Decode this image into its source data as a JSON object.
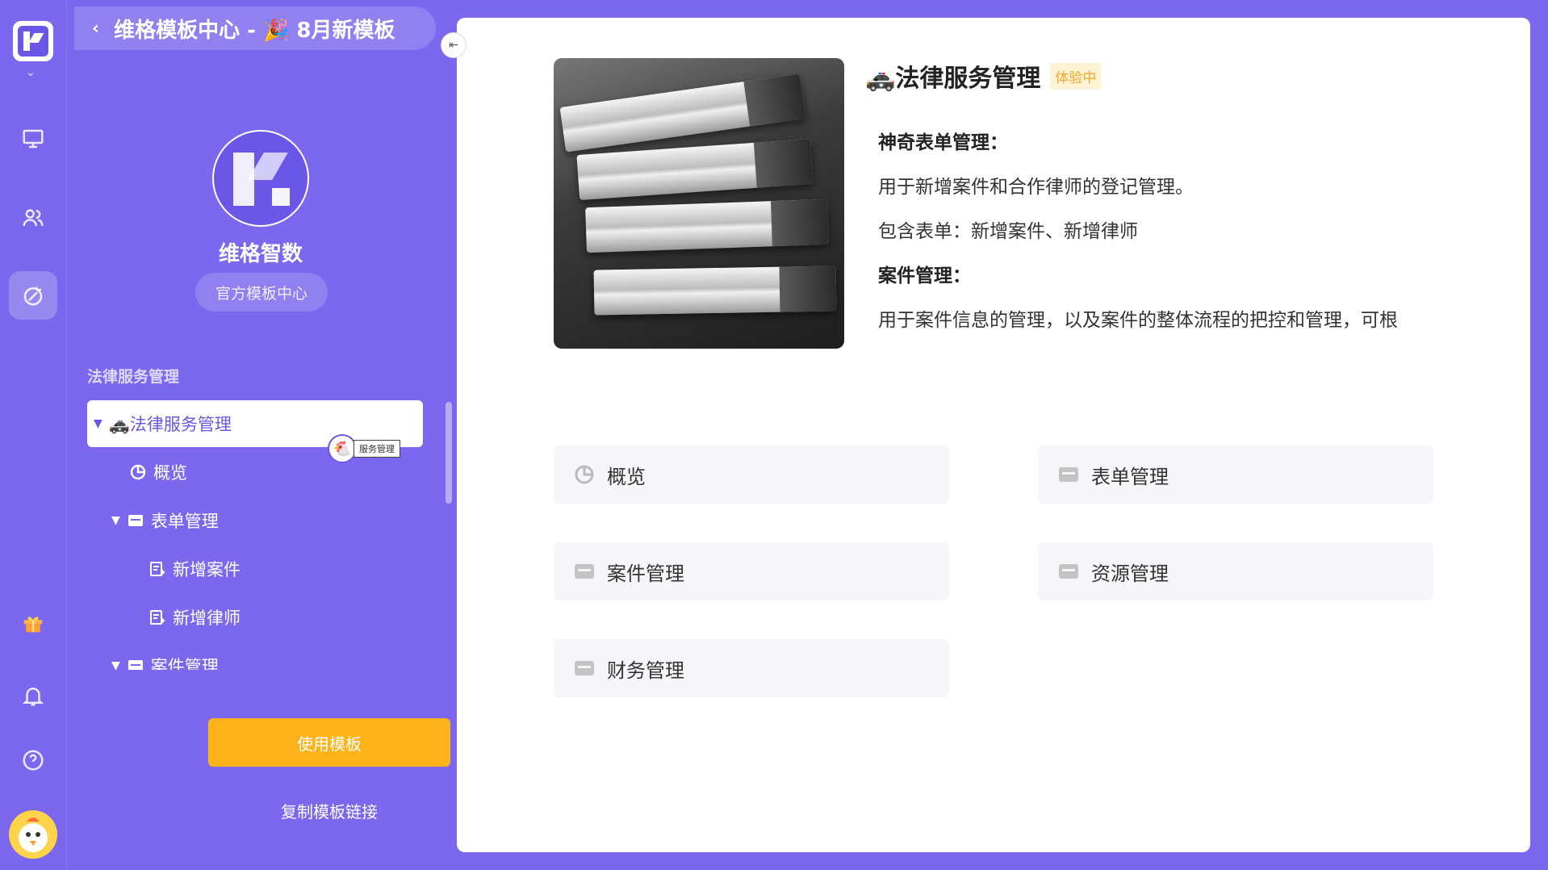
{
  "header": {
    "back_label": "‹",
    "title": "维格模板中心 - 🎉 8月新模板"
  },
  "org": {
    "name": "维格智数",
    "tag": "官方模板中心"
  },
  "sidebar": {
    "section_title": "法律服务管理",
    "tree": [
      {
        "label": "🚓法律服务管理",
        "depth": 0,
        "expanded": true,
        "selected": true,
        "icon": ""
      },
      {
        "label": "概览",
        "depth": 1,
        "icon": "dashboard-icon"
      },
      {
        "label": "表单管理",
        "depth": 1,
        "expanded": true,
        "icon": "folder-icon"
      },
      {
        "label": "新增案件",
        "depth": 2,
        "icon": "form-icon"
      },
      {
        "label": "新增律师",
        "depth": 2,
        "icon": "form-icon"
      },
      {
        "label": "案件管理",
        "depth": 1,
        "expanded": true,
        "icon": "folder-icon"
      }
    ],
    "floating_badge_label": "服务管理",
    "use_button": "使用模板",
    "copy_link": "复制模板链接"
  },
  "main": {
    "title": "🚓法律服务管理",
    "badge": "体验中",
    "desc": [
      {
        "text": "神奇表单管理：",
        "bold": true
      },
      {
        "text": "用于新增案件和合作律师的登记管理。",
        "bold": false
      },
      {
        "text": "包含表单：新增案件、新增律师",
        "bold": false
      },
      {
        "text": "案件管理：",
        "bold": true
      },
      {
        "text": "用于案件信息的管理，以及案件的整体流程的把控和管理，可根",
        "bold": false
      }
    ],
    "cards": [
      {
        "label": "概览",
        "icon": "dashboard-icon"
      },
      {
        "label": "表单管理",
        "icon": "folder-icon"
      },
      {
        "label": "案件管理",
        "icon": "folder-icon"
      },
      {
        "label": "资源管理",
        "icon": "folder-icon"
      },
      {
        "label": "财务管理",
        "icon": "folder-icon"
      }
    ]
  },
  "colors": {
    "brand": "#7b68ee",
    "accent_orange": "#ffb31a",
    "badge_bg": "#fff3d6",
    "badge_text": "#f5a623",
    "card_bg": "#f6f6fa"
  }
}
